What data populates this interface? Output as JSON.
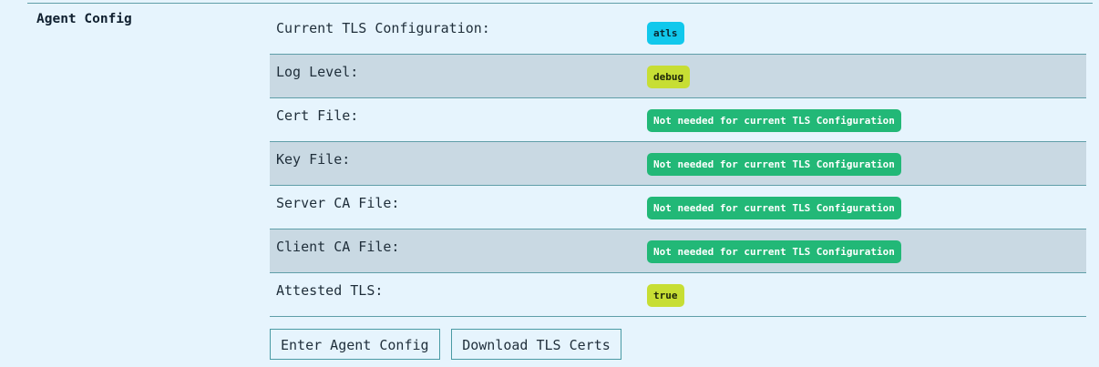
{
  "section": {
    "title": "Agent Config"
  },
  "rows": [
    {
      "label": "Current TLS Configuration:",
      "value": "atls"
    },
    {
      "label": "Log Level:",
      "value": "debug"
    },
    {
      "label": "Cert File:",
      "value": "Not needed for current TLS Configuration"
    },
    {
      "label": "Key File:",
      "value": "Not needed for current TLS Configuration"
    },
    {
      "label": "Server CA File:",
      "value": "Not needed for current TLS Configuration"
    },
    {
      "label": "Client CA File:",
      "value": "Not needed for current TLS Configuration"
    },
    {
      "label": "Attested TLS:",
      "value": "true"
    }
  ],
  "buttons": {
    "enter_config": "Enter Agent Config",
    "download_certs": "Download TLS Certs"
  },
  "colors": {
    "badge_tls": "#11c8ec",
    "badge_log": "#c7de34",
    "badge_not_needed": "#22b877",
    "badge_attested": "#c7de34"
  }
}
